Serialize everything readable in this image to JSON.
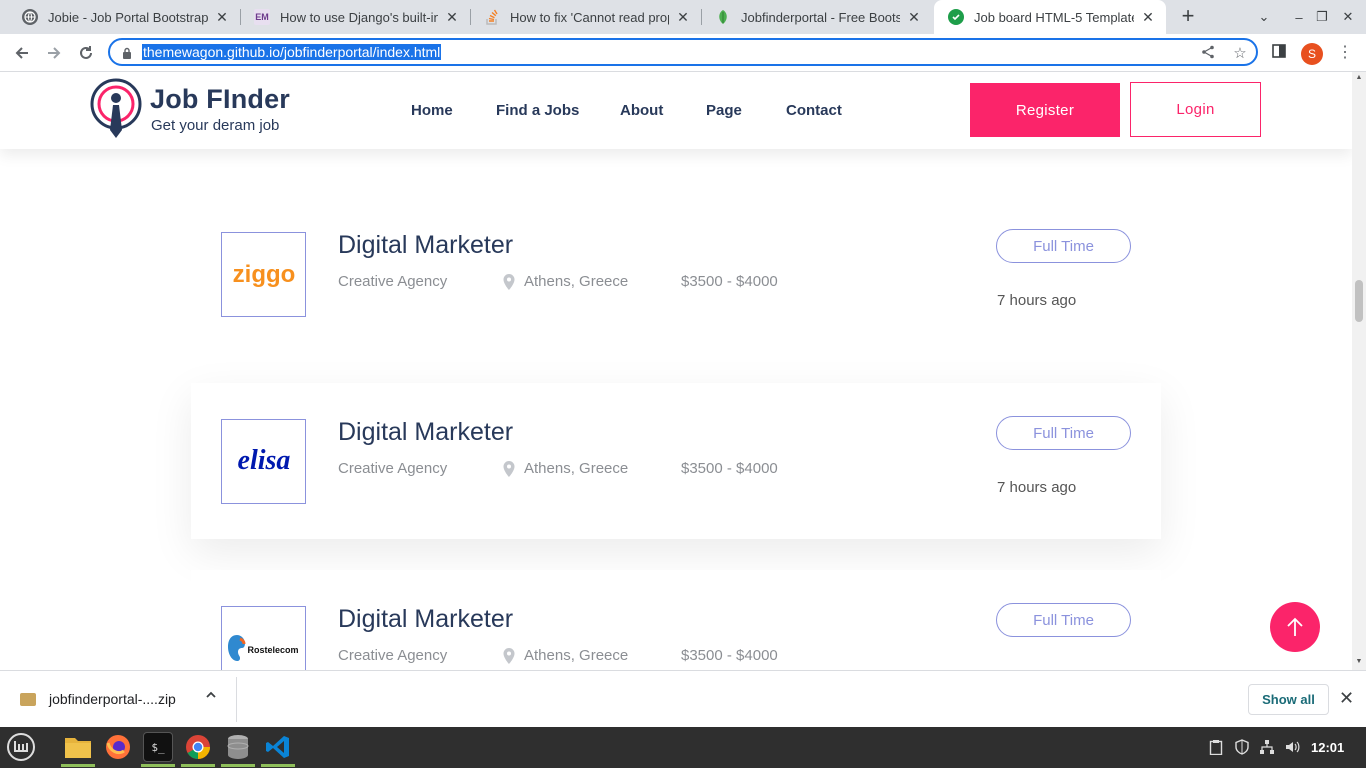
{
  "browser": {
    "tabs": [
      {
        "title": "Jobie - Job Portal Bootstrap",
        "favicon": "globe-icon",
        "fav_color": "#5f6368"
      },
      {
        "title": "How to use Django's built-in",
        "favicon": "em-icon",
        "fav_color": "#6d3a8c",
        "fav_text": "EM"
      },
      {
        "title": "How to fix 'Cannot read prop",
        "favicon": "stackoverflow-icon",
        "fav_color": "#f48024"
      },
      {
        "title": "Jobfinderportal - Free Boots",
        "favicon": "leaf-icon",
        "fav_color": "#4caf50"
      },
      {
        "title": "Job board HTML-5 Template",
        "favicon": "check-circle-icon",
        "fav_color": "#1e9e4a",
        "active": true
      }
    ],
    "url": "themewagon.github.io/jobfinderportal/index.html",
    "profile_initial": "S"
  },
  "site": {
    "brand_title": "Job FInder",
    "brand_subtitle": "Get your deram job",
    "nav": [
      "Home",
      "Find a Jobs",
      "About",
      "Page",
      "Contact"
    ],
    "register_label": "Register",
    "login_label": "Login",
    "accent_color": "#fb246a",
    "jobs": [
      {
        "logo": "ziggo-logo",
        "logo_text": "ziggo",
        "title": "Digital Marketer",
        "company": "Creative Agency",
        "location": "Athens, Greece",
        "salary": "$3500 - $4000",
        "type": "Full Time",
        "posted": "7 hours ago"
      },
      {
        "logo": "elisa-logo",
        "logo_text": "elisa",
        "title": "Digital Marketer",
        "company": "Creative Agency",
        "location": "Athens, Greece",
        "salary": "$3500 - $4000",
        "type": "Full Time",
        "posted": "7 hours ago"
      },
      {
        "logo": "rostelecom-logo",
        "logo_text": "Rostelecom",
        "title": "Digital Marketer",
        "company": "Creative Agency",
        "location": "Athens, Greece",
        "salary": "$3500 - $4000",
        "type": "Full Time"
      }
    ]
  },
  "downloads": {
    "file_name": "jobfinderportal-....zip",
    "show_all_label": "Show all"
  },
  "taskbar": {
    "apps": [
      "mint-menu-icon",
      "files-icon",
      "firefox-icon",
      "terminal-icon",
      "chrome-icon",
      "database-icon",
      "vscode-icon"
    ],
    "clock": "12:01"
  }
}
